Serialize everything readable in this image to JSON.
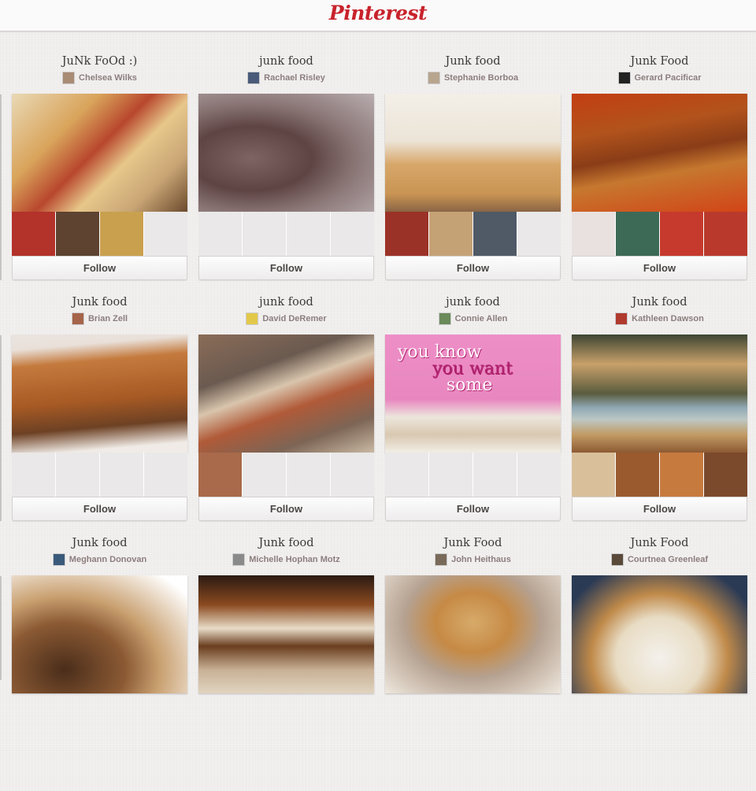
{
  "header": {
    "logo_text": "Pinterest"
  },
  "boards": [
    {
      "title": "JuNk FoOd :)",
      "owner": "Chelsea Wilks",
      "avatar": "#a88c74",
      "cover": "linear-gradient(135deg,#e9d9b6 0%,#d9a45b 30%,#b8472d 48%,#e7c78a 62%,#c9a575 80%,#6b4a2d 100%)",
      "thumbs": [
        "#b3322a",
        "#5d4330",
        "#c9a04e",
        ""
      ]
    },
    {
      "title": "junk food",
      "owner": "Rachael Risley",
      "avatar": "#4a5b7a",
      "cover": "radial-gradient(ellipse at 30% 55%,#7e6463 0%,#5e4544 35%,#8a7575 60%,#b9aeb0 100%)",
      "thumbs": [
        "",
        "",
        "",
        ""
      ]
    },
    {
      "title": "Junk food",
      "owner": "Stephanie Borboa",
      "avatar": "#b7a58e",
      "cover": "linear-gradient(180deg,#f3efe8 0%,#ece4d7 40%,#d7a769 60%,#c99454 85%,#8a6545 100%)",
      "thumbs": [
        "#9b3227",
        "#c5a276",
        "#4f5a66",
        ""
      ]
    },
    {
      "title": "Junk Food",
      "owner": "Gerard Pacificar",
      "avatar": "#222222",
      "cover": "linear-gradient(170deg,#c33e12 0%,#b2531c 30%,#8a3d17 50%,#c6782f 65%,#d24417 100%)",
      "thumbs": [
        "#e9e1e0",
        "#3c6a56",
        "#c63a2d",
        "#b93a2c"
      ]
    },
    {
      "title": "Junk food",
      "owner": "Brian Zell",
      "avatar": "#a6644a",
      "cover": "linear-gradient(175deg,#eae4df 0%,#e9e0d9 12%,#c47a3d 25%,#a75a24 55%,#6d4124 75%,#f0ebe6 92%)",
      "thumbs": [
        "",
        "",
        "",
        ""
      ]
    },
    {
      "title": "junk food",
      "owner": "David DeRemer",
      "avatar": "#e3c94a",
      "cover": "linear-gradient(160deg,#8a6c57 0%,#6b5a50 30%,#d9c5ad 45%,#b05a38 60%,#7d6555 80%,#c9b9a4 100%)",
      "thumbs": [
        "#a86a4a",
        "",
        "",
        ""
      ]
    },
    {
      "title": "junk food",
      "owner": "Connie Allen",
      "avatar": "#6a8a5a",
      "cover": "linear-gradient(180deg,#ee8ec7 0%,#e887bf 55%,#ece6dc 70%,#d9c8b1 85%,#f1ede5 100%)",
      "cover_text": [
        "you know",
        "you want",
        "some"
      ],
      "thumbs": [
        "",
        "",
        "",
        ""
      ]
    },
    {
      "title": "Junk food",
      "owner": "Kathleen Dawson",
      "avatar": "#b03a2e",
      "cover": "linear-gradient(180deg,#3d4633 0%,#c8a069 25%,#5a5c3f 50%,#8fa8b4 62%,#bcc7c3 72%,#c29a63 85%,#8d5a33 100%)",
      "thumbs": [
        "#d9c09b",
        "#9a5a2e",
        "#c77a3e",
        "#7b4a2c"
      ]
    },
    {
      "title": "Junk food",
      "owner": "Meghann Donovan",
      "avatar": "#3a5a7a",
      "cover": "radial-gradient(ellipse at 30% 80%,#4a2d1a 0%,#8b5a34 35%,#c9a070 55%,#ffffff 90%)",
      "thumbs": []
    },
    {
      "title": "Junk food",
      "owner": "Michelle Hophan Motz",
      "avatar": "#8a8a8a",
      "cover": "linear-gradient(180deg,#2a1a12 0%,#8b4a20 25%,#e8dcc8 45%,#6a3d1e 60%,#c8b095 80%,#e0d4c0 100%)",
      "thumbs": []
    },
    {
      "title": "Junk Food",
      "owner": "John Heithaus",
      "avatar": "#7a6a5a",
      "cover": "radial-gradient(ellipse at 50% 40%,#d7aa6a 0%,#c68a45 30%,#b5a190 55%,#efe8de 100%)",
      "thumbs": []
    },
    {
      "title": "Junk Food",
      "owner": "Courtnea Greenleaf",
      "avatar": "#5a4a3a",
      "cover": "radial-gradient(ellipse at 50% 70%,#f4f1ec 0%,#e8dcc4 35%,#c08a4a 55%,#2a3a55 85%)",
      "thumbs": []
    }
  ],
  "follow_label": "Follow"
}
